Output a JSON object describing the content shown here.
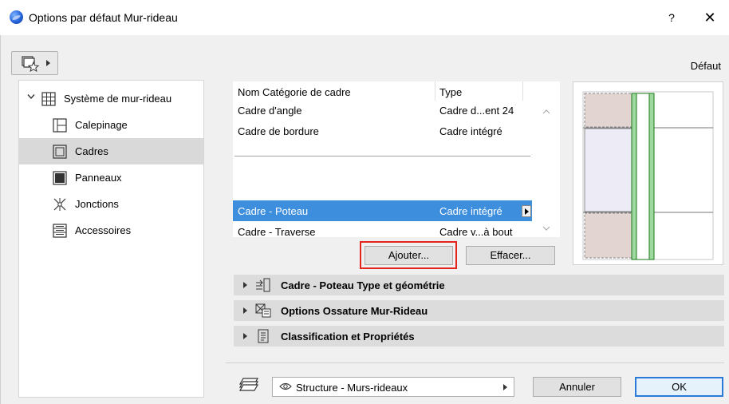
{
  "window": {
    "title": "Options par défaut Mur-rideau",
    "help_label": "?",
    "close_label": "✕"
  },
  "header": {
    "favorites_icon": "favorites-icon",
    "default_label": "Défaut"
  },
  "tree": {
    "root_label": "Système de mur-rideau",
    "items": [
      {
        "label": "Calepinage",
        "icon": "calepinage-icon"
      },
      {
        "label": "Cadres",
        "icon": "cadres-icon",
        "selected": true
      },
      {
        "label": "Panneaux",
        "icon": "panneaux-icon"
      },
      {
        "label": "Jonctions",
        "icon": "jonctions-icon"
      },
      {
        "label": "Accessoires",
        "icon": "accessoires-icon"
      }
    ]
  },
  "categories": {
    "header_name": "Nom Catégorie de cadre",
    "header_type": "Type",
    "rows": [
      {
        "name": "Cadre d'angle",
        "type": "Cadre d...ent 24"
      },
      {
        "name": "Cadre de bordure",
        "type": "Cadre intégré"
      },
      {
        "name": "Cadre - Poteau",
        "type": "Cadre intégré",
        "selected": true
      },
      {
        "name": "Cadre - Traverse",
        "type": "Cadre v...à bout"
      }
    ]
  },
  "buttons": {
    "add": "Ajouter...",
    "delete": "Effacer...",
    "cancel": "Annuler",
    "ok": "OK"
  },
  "sections": [
    {
      "title": "Cadre - Poteau Type et géométrie",
      "icon": "frame-type-icon"
    },
    {
      "title": "Options Ossature Mur-Rideau",
      "icon": "framing-options-icon"
    },
    {
      "title": "Classification et Propriétés",
      "icon": "classification-icon"
    }
  ],
  "footer": {
    "layer_value": "Structure - Murs-rideaux"
  },
  "colors": {
    "selection": "#3e8ede",
    "highlight": "#e3241b",
    "ok_border": "#2b7ad9"
  }
}
